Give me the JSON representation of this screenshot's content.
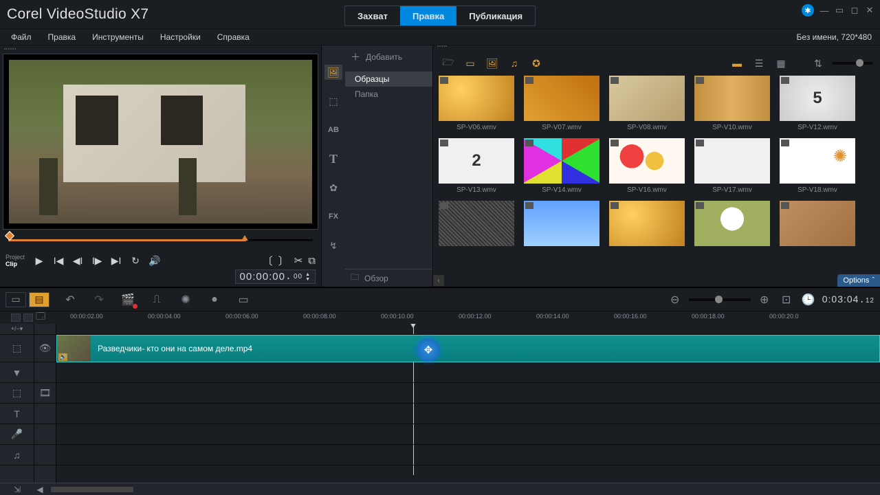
{
  "app_title": "Corel VideoStudio X7",
  "mode_tabs": {
    "capture": "Захват",
    "edit": "Правка",
    "share": "Публикация"
  },
  "active_mode": "Правка",
  "menu": {
    "file": "Файл",
    "edit": "Правка",
    "tools": "Инструменты",
    "settings": "Настройки",
    "help": "Справка"
  },
  "project_info": "Без имени, 720*480",
  "preview": {
    "project_label": "Project",
    "clip_label": "Clip",
    "timecode": "00:00:00",
    "timecode_frames": "00"
  },
  "library": {
    "add_label": "Добавить",
    "folders": {
      "samples": "Образцы",
      "folder": "Папка"
    },
    "browse_label": "Обзор",
    "options_label": "Options",
    "items_row1": [
      {
        "label": "SP-V06.wmv",
        "cls": "t-gold"
      },
      {
        "label": "SP-V07.wmv",
        "cls": "t-gold2"
      },
      {
        "label": "SP-V08.wmv",
        "cls": "t-map"
      },
      {
        "label": "SP-V10.wmv",
        "cls": "t-film"
      },
      {
        "label": "SP-V12.wmv",
        "cls": "t-count",
        "text": "5"
      }
    ],
    "items_row2": [
      {
        "label": "SP-V13.wmv",
        "cls": "t-white",
        "text": "2"
      },
      {
        "label": "SP-V14.wmv",
        "cls": "t-testcard"
      },
      {
        "label": "SP-V16.wmv",
        "cls": "t-balloons"
      },
      {
        "label": "SP-V17.wmv",
        "cls": "t-white"
      },
      {
        "label": "SP-V18.wmv",
        "cls": "t-sun"
      }
    ],
    "items_row3": [
      {
        "label": "",
        "cls": "t-noise"
      },
      {
        "label": "",
        "cls": "t-sky"
      },
      {
        "label": "",
        "cls": "t-gold"
      },
      {
        "label": "",
        "cls": "t-dand"
      },
      {
        "label": "",
        "cls": "t-sand"
      }
    ]
  },
  "timeline": {
    "duration": "0:03:04",
    "duration_frames": "12",
    "ticks": [
      "00:00:02.00",
      "00:00:04.00",
      "00:00:06.00",
      "00:00:08.00",
      "00:00:10.00",
      "00:00:12.00",
      "00:00:14.00",
      "00:00:16.00",
      "00:00:18.00",
      "00:00:20.0"
    ],
    "clip_name": "Разведчики- кто они на самом деле.mp4",
    "playhead_pct": 44
  }
}
